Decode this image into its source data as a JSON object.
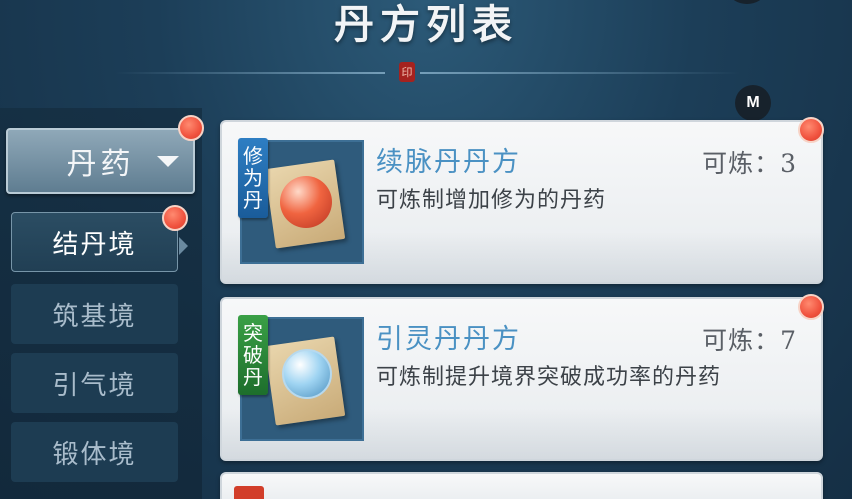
{
  "header": {
    "title": "丹方列表",
    "seal_char": "印",
    "m_badge": "M"
  },
  "sidebar": {
    "category": "丹药",
    "realms": [
      {
        "label": "结丹境",
        "active": true,
        "has_dot": true
      },
      {
        "label": "筑基境",
        "active": false
      },
      {
        "label": "引气境",
        "active": false
      },
      {
        "label": "锻体境",
        "active": false
      }
    ]
  },
  "recipes": [
    {
      "name": "续脉丹丹方",
      "craftable_label": "可炼：3",
      "description": "可炼制增加修为的丹药",
      "tag": [
        "修",
        "为",
        "丹"
      ],
      "tag_color": "#2e7ec3",
      "icon": "red-pill-scroll-icon"
    },
    {
      "name": "引灵丹丹方",
      "craftable_label": "可炼：7",
      "description": "可炼制提升境界突破成功率的丹药",
      "tag": [
        "突",
        "破",
        "丹"
      ],
      "tag_color": "#3aa046",
      "icon": "blue-orb-scroll-icon"
    }
  ],
  "colors": {
    "accent_blue": "#4a91c3",
    "notify_red": "#f0523e"
  }
}
